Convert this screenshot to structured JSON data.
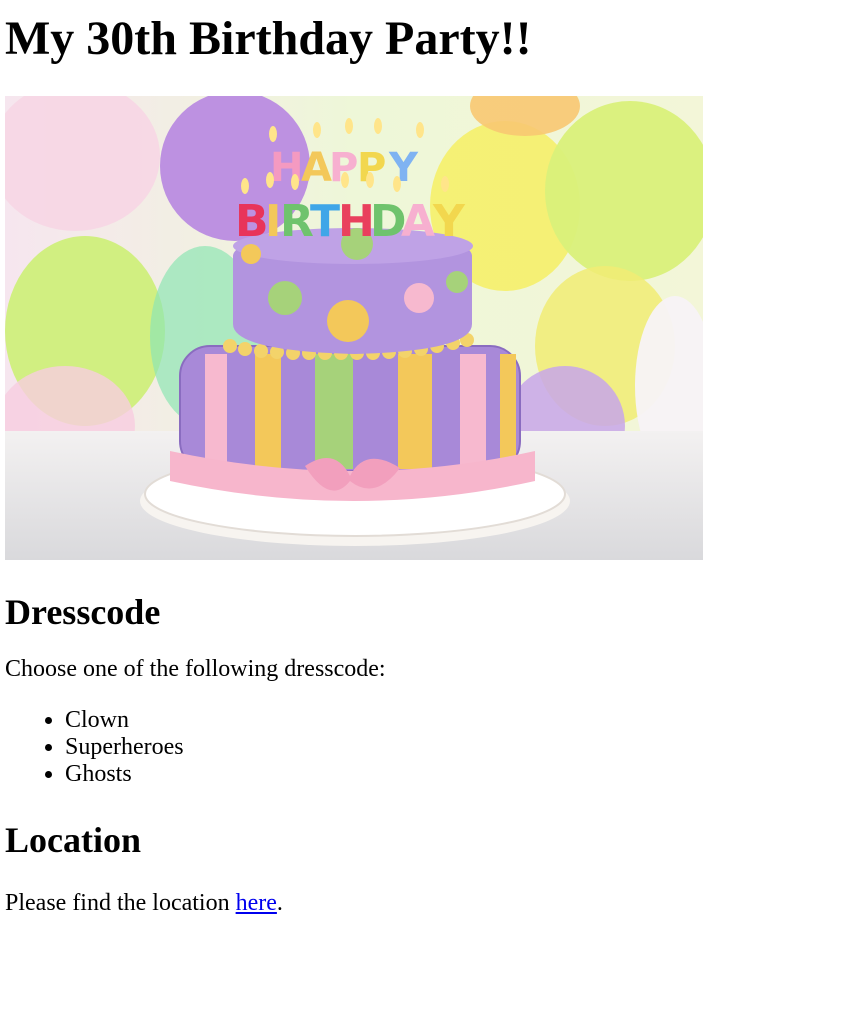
{
  "page": {
    "title": "My 30th Birthday Party!!"
  },
  "hero": {
    "image_semantic": "birthday-cake-photo",
    "cake_topper_text": "HAPPY BIRTHDAY"
  },
  "dresscode": {
    "heading": "Dresscode",
    "intro": "Choose one of the following dresscode:",
    "items": [
      "Clown",
      "Superheroes",
      "Ghosts"
    ]
  },
  "location": {
    "heading": "Location",
    "text_before": "Please find the location ",
    "link_label": "here",
    "text_after": "."
  },
  "colors": {
    "link": "#0000ee",
    "text": "#000000",
    "background": "#ffffff"
  }
}
